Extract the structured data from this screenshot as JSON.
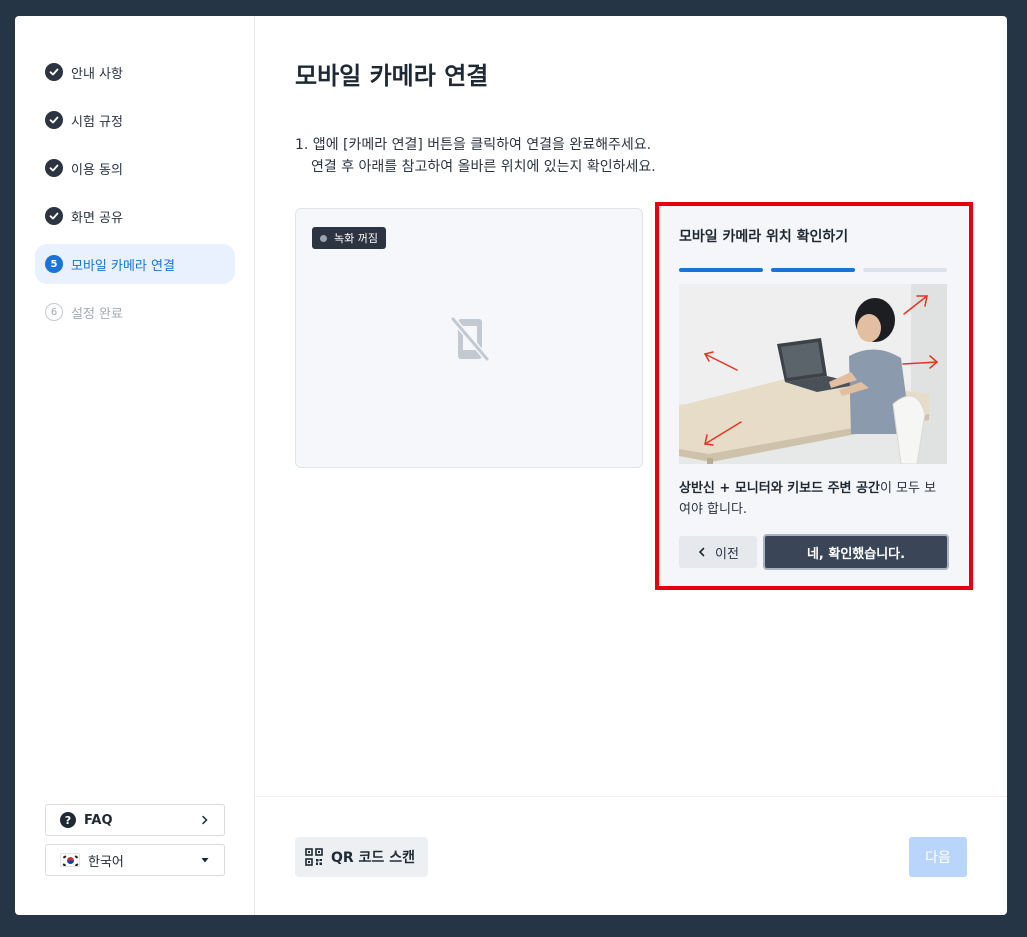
{
  "colors": {
    "frame": "#253545",
    "accent": "#1a73d9",
    "dark": "#2b3440",
    "progress_active": "#1a73d9",
    "progress_inactive": "#dde2e8",
    "highlight_border": "#e8000d",
    "next_disabled": "#b9d5fb"
  },
  "sidebar": {
    "steps": [
      {
        "label": "안내 사항",
        "state": "done",
        "icon": "check-icon"
      },
      {
        "label": "시험 규정",
        "state": "done",
        "icon": "check-icon"
      },
      {
        "label": "이용 동의",
        "state": "done",
        "icon": "check-icon"
      },
      {
        "label": "화면 공유",
        "state": "done",
        "icon": "check-icon"
      },
      {
        "label": "모바일 카메라 연결",
        "state": "active",
        "number": "5"
      },
      {
        "label": "설정 완료",
        "state": "pending",
        "number": "6"
      }
    ],
    "faq_label": "FAQ",
    "language_label": "한국어"
  },
  "main": {
    "title": "모바일 카메라 연결",
    "instruction_line1": "1. 앱에 [카메라 연결] 버튼을 클릭하여 연결을 완료해주세요.",
    "instruction_line2": "연결 후 아래를 참고하여 올바른 위치에 있는지 확인하세요.",
    "recording_badge": "녹화 꺼짐",
    "camera_icon": "phone-off-icon"
  },
  "guide": {
    "title": "모바일 카메라 위치 확인하기",
    "progress": {
      "total_steps": 3,
      "completed_steps": 2
    },
    "description_bold": "상반신 + 모니터와 키보드 주변 공간",
    "description_rest": "이 모두 보여야 합니다.",
    "prev_label": "이전",
    "confirm_label": "네, 확인했습니다."
  },
  "footer": {
    "qr_label": "QR 코드 스캔",
    "next_label": "다음"
  }
}
